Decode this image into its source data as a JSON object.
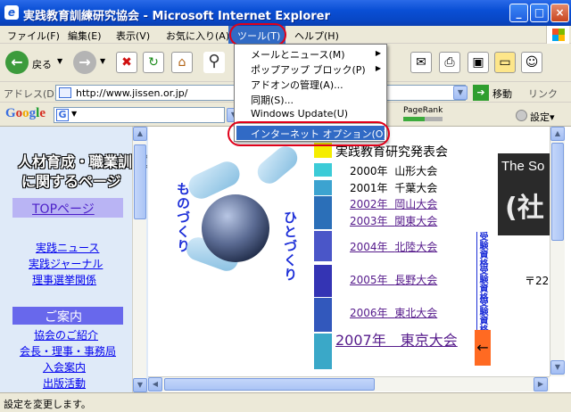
{
  "window": {
    "title": "実践教育訓練研究協会 - Microsoft Internet Explorer",
    "min": "_",
    "max": "□",
    "close": "×"
  },
  "menubar": {
    "items": [
      "ファイル(F)",
      "編集(E)",
      "表示(V)",
      "お気に入り(A)",
      "ツール(T)",
      "ヘルプ(H)"
    ]
  },
  "toolbar": {
    "back_label": "戻る"
  },
  "address": {
    "label": "アドレス(D)",
    "url": "http://www.jissen.or.jp/",
    "go_label": "移動",
    "links_label": "リンク"
  },
  "googlebar": {
    "logo": "Google",
    "search_label": "検",
    "pagerank_label": "PageRank",
    "settings_label": "設定▾"
  },
  "tools_menu": {
    "items": [
      {
        "label": "メールとニュース(M)",
        "submenu": true
      },
      {
        "label": "ポップアップ ブロック(P)",
        "submenu": true
      },
      {
        "label": "アドオンの管理(A)...",
        "submenu": false
      },
      {
        "label": "同期(S)...",
        "submenu": false
      },
      {
        "label": "Windows Update(U)",
        "submenu": false
      }
    ],
    "highlighted": "インターネット オプション(O)..."
  },
  "left_nav": {
    "heading1": "人材育成・職業訓練",
    "heading2": "に関するページ",
    "top_link": "TOPページ",
    "links": [
      "実践ニュース",
      "実践ジャーナル",
      "理事選挙関係"
    ],
    "guide_heading": "ご案内",
    "guide_links": [
      "協会のご紹介",
      "会長・理事・事務局",
      "入会案内",
      "出版活動"
    ]
  },
  "main": {
    "vertical_left": "ものづくり",
    "vertical_right": "ひとづくり",
    "conference_title": "実践教育研究発表会",
    "conferences": [
      {
        "year": "2000年",
        "place": "山形大会",
        "linked": false
      },
      {
        "year": "2001年",
        "place": "千葉大会",
        "linked": false
      },
      {
        "year": "2002年",
        "place": "岡山大会",
        "linked": true
      },
      {
        "year": "2003年",
        "place": "関東大会",
        "linked": true
      },
      {
        "year": "2004年",
        "place": "北陸大会",
        "linked": true
      },
      {
        "year": "2005年",
        "place": "長野大会",
        "linked": true
      },
      {
        "year": "2006年",
        "place": "東北大会",
        "linked": true
      }
    ],
    "latest_conference": "2007年　東京大会",
    "side_vertical": "受験資格",
    "arrow": "←",
    "banner_text": "The So",
    "banner_big": "(社",
    "postal": "〒22"
  },
  "status": {
    "text": "設定を変更します。"
  },
  "colors": {
    "title_bar": "#0a4fd5",
    "highlight": "#316ac5",
    "annotation_ring": "#e0001a"
  }
}
